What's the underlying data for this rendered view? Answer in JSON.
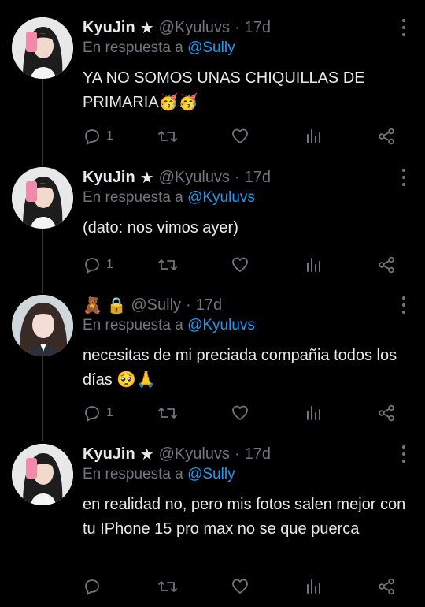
{
  "tweets": [
    {
      "name": "KyuJin",
      "star": "★",
      "handle": "@Kyuluvs",
      "dot": "·",
      "time": "17d",
      "reply_prefix": "En respuesta a",
      "reply_to": "@Sully",
      "text": "YA NO SOMOS UNAS CHIQUILLAS DE PRIMARIA🥳🥳",
      "reply_count": "1"
    },
    {
      "name": "KyuJin",
      "star": "★",
      "handle": "@Kyuluvs",
      "dot": "·",
      "time": "17d",
      "reply_prefix": "En respuesta a",
      "reply_to": "@Kyuluvs",
      "text": "(dato: nos vimos ayer)",
      "reply_count": "1"
    },
    {
      "name_icons": "🧸 🔒",
      "handle": "@Sully",
      "dot": "·",
      "time": "17d",
      "reply_prefix": "En respuesta a",
      "reply_to": "@Kyuluvs",
      "text": "necesitas de mi preciada compañia todos los días 🥺🙏",
      "reply_count": "1"
    },
    {
      "name": "KyuJin",
      "star": "★",
      "handle": "@Kyuluvs",
      "dot": "·",
      "time": "17d",
      "reply_prefix": "En respuesta a",
      "reply_to": "@Sully",
      "text": "en realidad no, pero mis fotos salen mejor con tu IPhone 15 pro max no se que puerca",
      "reply_count": ""
    }
  ],
  "icons": {
    "reply": "reply-icon",
    "retweet": "retweet-icon",
    "like": "heart-icon",
    "views": "views-icon",
    "share": "share-icon",
    "more": "more-icon"
  },
  "colors": {
    "background": "#000000",
    "text": "#e7e9ea",
    "muted": "#71767b",
    "link": "#1d9bf0"
  }
}
